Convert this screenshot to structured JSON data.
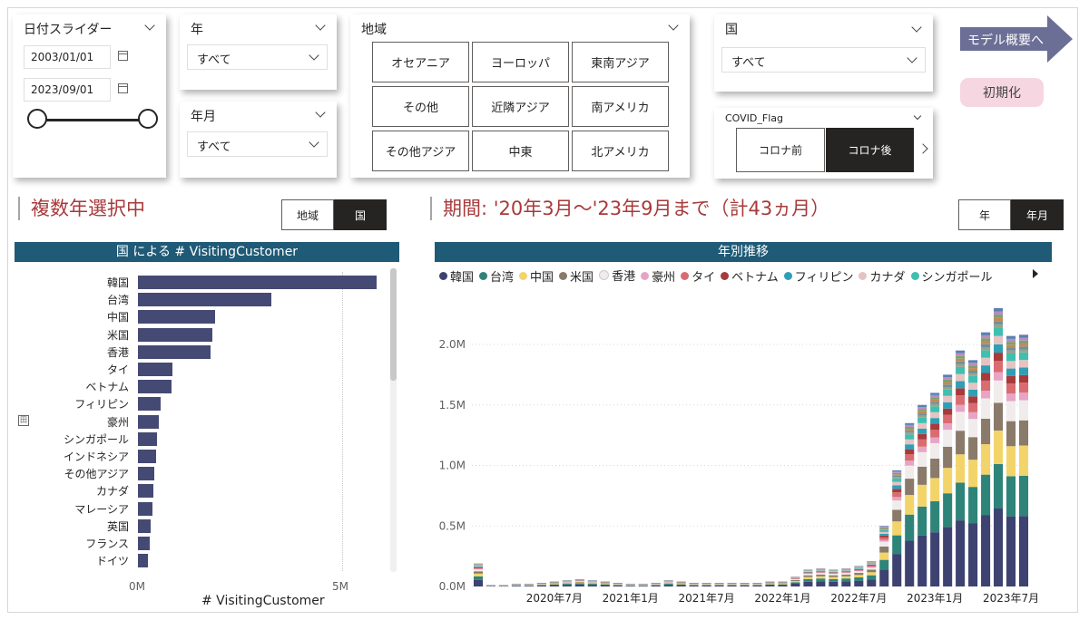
{
  "date_slicer": {
    "title": "日付スライダー",
    "start": "2003/01/01",
    "end": "2023/09/01"
  },
  "year_slicer": {
    "title": "年",
    "value": "すべて"
  },
  "yearmonth_slicer": {
    "title": "年月",
    "value": "すべて"
  },
  "region_slicer": {
    "title": "地域",
    "tiles": [
      "オセアニア",
      "ヨーロッパ",
      "東南アジア",
      "その他",
      "近隣アジア",
      "南アメリカ",
      "その他アジア",
      "中東",
      "北アメリカ"
    ]
  },
  "country_slicer": {
    "title": "国",
    "value": "すべて"
  },
  "covid_slicer": {
    "title": "COVID_Flag",
    "options": [
      "コロナ前",
      "コロナ後"
    ],
    "selected": "コロナ後"
  },
  "nav": {
    "model_overview": "モデル概要へ",
    "reset": "初期化"
  },
  "left_section": {
    "title": "複数年選択中",
    "toggle": [
      "地域",
      "国"
    ],
    "toggle_selected": "国"
  },
  "right_section": {
    "title": "期間: '20年3月～'23年9月まで（計43ヵ月）",
    "toggle": [
      "年",
      "年月"
    ],
    "toggle_selected": "年月"
  },
  "colors": {
    "header": "#1f5a76",
    "bar": "#454a74",
    "title_red": "#a83a3a"
  },
  "bar_chart": {
    "title": "国 による # VisitingCustomer",
    "xlabel": "# VisitingCustomer",
    "x_ticks": [
      "0M",
      "5M"
    ],
    "chart_data": {
      "type": "bar",
      "orientation": "horizontal",
      "categories": [
        "韓国",
        "台湾",
        "中国",
        "米国",
        "香港",
        "タイ",
        "ベトナム",
        "フィリピン",
        "豪州",
        "シンガポール",
        "インドネシア",
        "その他アジア",
        "カナダ",
        "マレーシア",
        "英国",
        "フランス",
        "ドイツ"
      ],
      "values": [
        5.9,
        3.3,
        1.9,
        1.85,
        1.8,
        0.85,
        0.82,
        0.57,
        0.52,
        0.48,
        0.45,
        0.4,
        0.38,
        0.36,
        0.32,
        0.3,
        0.25
      ],
      "xlim": [
        0,
        6.2
      ],
      "unit": "M"
    }
  },
  "stacked_chart": {
    "title": "年別推移",
    "legend": [
      "韓国",
      "台湾",
      "中国",
      "米国",
      "香港",
      "豪州",
      "タイ",
      "ベトナム",
      "フィリピン",
      "カナダ",
      "シンガポール"
    ],
    "legend_colors": [
      "#3d4270",
      "#2e8479",
      "#f2d46b",
      "#8a7a6a",
      "#f1ecec",
      "#e6a5c5",
      "#d96c71",
      "#a83a3a",
      "#2f9fb6",
      "#e6c3c3",
      "#3fbfb0"
    ],
    "other_color": "#9aa28b",
    "y_ticks": [
      "0.0M",
      "0.5M",
      "1.0M",
      "1.5M",
      "2.0M"
    ],
    "x_ticks": [
      "2020年7月",
      "2021年1月",
      "2021年7月",
      "2022年1月",
      "2022年7月",
      "2023年1月",
      "2023年7月"
    ],
    "chart_data": {
      "type": "bar",
      "stacked": true,
      "ylim": [
        0,
        2.3
      ],
      "unit": "M",
      "month_totals": [
        0.19,
        0.01,
        0.01,
        0.02,
        0.02,
        0.03,
        0.04,
        0.05,
        0.06,
        0.05,
        0.04,
        0.03,
        0.02,
        0.02,
        0.03,
        0.05,
        0.04,
        0.03,
        0.03,
        0.03,
        0.03,
        0.03,
        0.03,
        0.04,
        0.04,
        0.08,
        0.14,
        0.15,
        0.14,
        0.15,
        0.17,
        0.21,
        0.5,
        0.96,
        1.35,
        1.5,
        1.6,
        1.75,
        1.95,
        1.87,
        2.1,
        2.3,
        2.07,
        2.08
      ]
    }
  }
}
